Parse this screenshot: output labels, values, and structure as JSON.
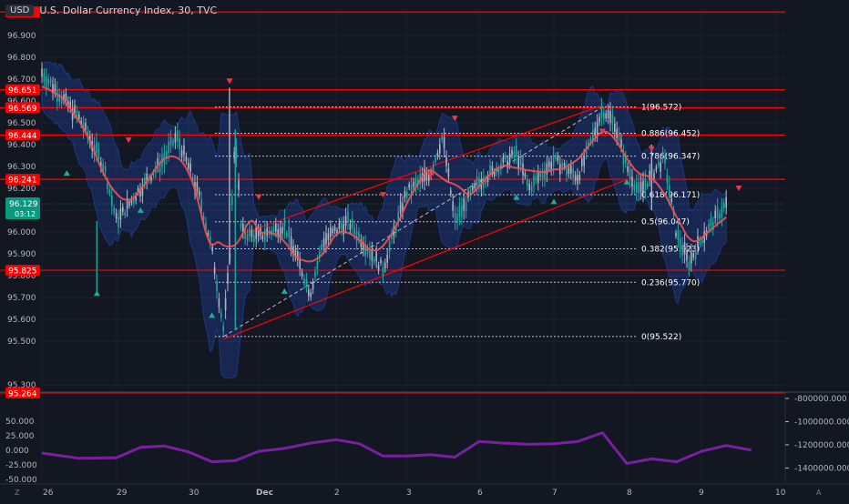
{
  "header": {
    "currency_badge": "USD",
    "title": "U.S. Dollar Currency Index, 30, TVC"
  },
  "colors": {
    "background": "#131722",
    "grid": "#1e222d",
    "axis_text": "#d1d4dc",
    "hline": "#ff0000",
    "candle_up": "#26a69a",
    "candle_down": "#b0b6c0",
    "band_fill": "#2962ff",
    "ma": "#ef5350",
    "fib": "#ffffff",
    "oscillator": "#7b1fa2",
    "last_price": "#089981"
  },
  "chart_data": [
    {
      "type": "candlestick",
      "title": "U.S. Dollar Currency Index, 30, TVC",
      "ylim": [
        95.28,
        97.02
      ],
      "price_axis_ticks": [
        "97.000",
        "96.900",
        "96.800",
        "96.700",
        "96.600",
        "96.500",
        "96.400",
        "96.300",
        "96.200",
        "96.100",
        "96.000",
        "95.900",
        "95.800",
        "95.700",
        "95.600",
        "95.500",
        "95.300"
      ],
      "x_axis_ticks": [
        "26",
        "29",
        "30",
        "Dec",
        "2",
        "3",
        "6",
        "7",
        "8",
        "9",
        "10"
      ],
      "horizontal_levels": [
        97.007,
        96.651,
        96.569,
        96.444,
        96.241,
        95.825,
        95.264
      ],
      "level_labels": [
        "96.651",
        "96.569",
        "96.444",
        "96.241",
        "95.825",
        "95.264"
      ],
      "last_price": {
        "value": "96.129",
        "countdown": "03:12"
      },
      "fibonacci": [
        {
          "label": "1(96.572)",
          "value": 96.572
        },
        {
          "label": "0.886(96.452)",
          "value": 96.452
        },
        {
          "label": "0.786(96.347)",
          "value": 96.347
        },
        {
          "label": "0.618(96.171)",
          "value": 96.171
        },
        {
          "label": "0.5(96.047)",
          "value": 96.047
        },
        {
          "label": "0.382(95.923)",
          "value": 95.923
        },
        {
          "label": "0.236(95.770)",
          "value": 95.77
        },
        {
          "label": "0(95.522)",
          "value": 95.522
        }
      ],
      "channel": {
        "upper": [
          [
            "Nov 30 18:00",
            95.99
          ],
          [
            "Dec 7 16:00",
            96.58
          ]
        ],
        "lower": [
          [
            "Nov 30 12:00",
            95.51
          ],
          [
            "Dec 8 00:00",
            96.24
          ]
        ]
      },
      "fib_trend": [
        [
          "Nov 30 12:00",
          95.522
        ],
        [
          "Dec 7 16:00",
          96.572
        ]
      ],
      "price_path": [
        [
          "Nov 26 00:00",
          96.73
        ],
        [
          "Nov 26 12:00",
          96.52
        ],
        [
          "Nov 26 20:00",
          96.3
        ],
        [
          "Nov 29 00:00",
          96.05
        ],
        [
          "Nov 29 08:00",
          96.2
        ],
        [
          "Nov 29 16:00",
          96.34
        ],
        [
          "Nov 29 20:00",
          96.44
        ],
        [
          "Nov 30 00:00",
          96.3
        ],
        [
          "Nov 30 04:00",
          96.15
        ],
        [
          "Nov 30 08:00",
          95.92
        ],
        [
          "Nov 30 12:00",
          95.55
        ],
        [
          "Nov 30 14:00",
          95.86
        ],
        [
          "Nov 30 16:00",
          96.47
        ],
        [
          "Nov 30 18:00",
          96.0
        ],
        [
          "Dec 1 00:00",
          95.98
        ],
        [
          "Dec 1 08:00",
          96.03
        ],
        [
          "Dec 1 16:00",
          95.72
        ],
        [
          "Dec 1 20:00",
          95.96
        ],
        [
          "Dec 2 04:00",
          96.05
        ],
        [
          "Dec 2 16:00",
          95.83
        ],
        [
          "Dec 3 00:00",
          96.18
        ],
        [
          "Dec 3 08:00",
          96.27
        ],
        [
          "Dec 3 12:00",
          96.44
        ],
        [
          "Dec 3 16:00",
          96.05
        ],
        [
          "Dec 6 00:00",
          96.23
        ],
        [
          "Dec 6 12:00",
          96.36
        ],
        [
          "Dec 6 16:00",
          96.2
        ],
        [
          "Dec 7 00:00",
          96.33
        ],
        [
          "Dec 7 08:00",
          96.25
        ],
        [
          "Dec 7 16:00",
          96.56
        ],
        [
          "Dec 7 20:00",
          96.5
        ],
        [
          "Dec 8 00:00",
          96.3
        ],
        [
          "Dec 8 04:00",
          96.18
        ],
        [
          "Dec 8 12:00",
          96.34
        ],
        [
          "Dec 8 16:00",
          95.99
        ],
        [
          "Dec 8 20:00",
          95.86
        ],
        [
          "Dec 9 00:00",
          95.97
        ],
        [
          "Dec 9 08:00",
          96.13
        ]
      ],
      "signals_down": [
        [
          "Nov 29 04:00",
          96.42
        ],
        [
          "Nov 30 14:00",
          96.69
        ],
        [
          "Dec 1 00:00",
          96.16
        ],
        [
          "Dec 2 16:00",
          96.17
        ],
        [
          "Dec 3 08:00",
          96.26
        ],
        [
          "Dec 3 16:00",
          96.52
        ],
        [
          "Dec 7 16:00",
          96.46
        ],
        [
          "Dec 8 08:00",
          96.38
        ],
        [
          "Dec 9 12:00",
          96.2
        ]
      ],
      "signals_up": [
        [
          "Nov 26 08:00",
          96.27
        ],
        [
          "Nov 28 04:00",
          95.72
        ],
        [
          "Nov 29 08:00",
          96.1
        ],
        [
          "Nov 30 08:00",
          95.62
        ],
        [
          "Dec 1 08:00",
          95.73
        ],
        [
          "Dec 6 12:00",
          96.16
        ],
        [
          "Dec 7 00:00",
          96.14
        ],
        [
          "Dec 8 00:00",
          96.23
        ]
      ]
    },
    {
      "type": "line",
      "title": "",
      "ylim": [
        -55,
        95
      ],
      "left_axis_ticks": [
        "50.000",
        "25.000",
        "0.000",
        "-25.000",
        "-50.000"
      ],
      "right_axis_ticks": [
        "-800000.000",
        "-1000000.000",
        "-1200000.000",
        "-1400000.000"
      ],
      "x": [
        "Nov 26 00:00",
        "Nov 26 12:00",
        "Nov 29 00:00",
        "Nov 29 08:00",
        "Nov 29 16:00",
        "Nov 30 00:00",
        "Nov 30 08:00",
        "Nov 30 16:00",
        "Dec 1 00:00",
        "Dec 1 08:00",
        "Dec 1 16:00",
        "Dec 2 00:00",
        "Dec 2 08:00",
        "Dec 2 16:00",
        "Dec 3 00:00",
        "Dec 3 08:00",
        "Dec 3 16:00",
        "Dec 6 00:00",
        "Dec 6 08:00",
        "Dec 6 16:00",
        "Dec 7 00:00",
        "Dec 7 08:00",
        "Dec 7 16:00",
        "Dec 8 00:00",
        "Dec 8 08:00",
        "Dec 8 16:00",
        "Dec 9 00:00",
        "Dec 9 08:00",
        "Dec 9 16:00"
      ],
      "values": [
        -5,
        -14,
        -13,
        5,
        7,
        -3,
        -20,
        -18,
        -2,
        3,
        12,
        18,
        11,
        -10,
        -10,
        -8,
        -12,
        15,
        12,
        10,
        11,
        15,
        30,
        -23,
        -15,
        -20,
        -2,
        8,
        0
      ]
    }
  ]
}
